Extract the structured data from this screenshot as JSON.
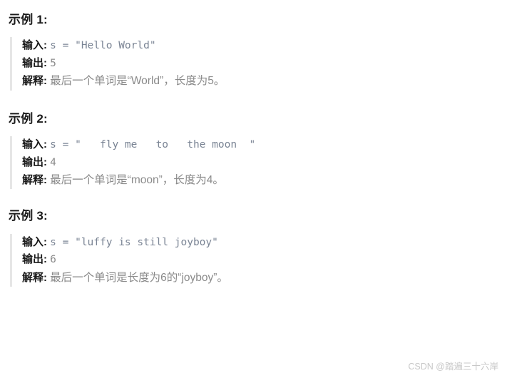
{
  "labels": {
    "input": "输入:",
    "output": "输出:",
    "explanation": "解释:"
  },
  "examples": [
    {
      "title": "示例 1:",
      "input": "s = \"Hello World\"",
      "output": "5",
      "explanation": "最后一个单词是“World”，长度为5。"
    },
    {
      "title": "示例 2:",
      "input": "s = \"   fly me   to   the moon  \"",
      "output": "4",
      "explanation": "最后一个单词是“moon”，长度为4。"
    },
    {
      "title": "示例 3:",
      "input": "s = \"luffy is still joyboy\"",
      "output": "6",
      "explanation": "最后一个单词是长度为6的“joyboy”。"
    }
  ],
  "watermark": "CSDN @踏遍三十六岸",
  "colors": {
    "label_text": "#1a1a1a",
    "code_text": "#7a8494",
    "value_text": "#8a8a8a",
    "explanation_text": "#8a8a8a",
    "quote_border": "#e6e6e6",
    "watermark_text": "#c8c8c8",
    "background": "#ffffff"
  }
}
